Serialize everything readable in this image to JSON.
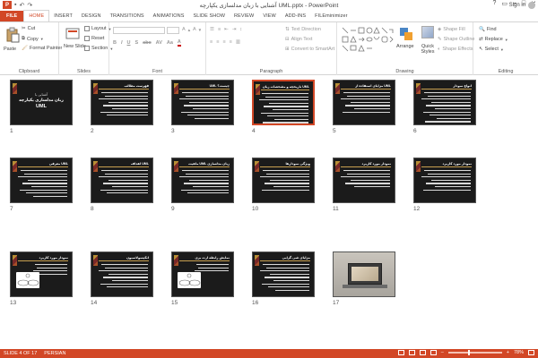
{
  "window": {
    "title": "آشنایی با زبان مدلسازی یکپارچه UML.pptx - PowerPoint",
    "app_icon": "P",
    "controls": [
      "?",
      "▭",
      "–",
      "□",
      "✕"
    ]
  },
  "qat": {
    "save_icon": "save-icon",
    "undo_icon": "undo-icon",
    "redo_icon": "redo-icon"
  },
  "tabs": [
    {
      "label": "FILE",
      "type": "file"
    },
    {
      "label": "HOME",
      "type": "active"
    },
    {
      "label": "INSERT",
      "type": ""
    },
    {
      "label": "DESIGN",
      "type": ""
    },
    {
      "label": "TRANSITIONS",
      "type": ""
    },
    {
      "label": "ANIMATIONS",
      "type": ""
    },
    {
      "label": "SLIDE SHOW",
      "type": ""
    },
    {
      "label": "REVIEW",
      "type": ""
    },
    {
      "label": "VIEW",
      "type": ""
    },
    {
      "label": "ADD-INS",
      "type": ""
    },
    {
      "label": "FILEminimizer",
      "type": ""
    }
  ],
  "signin": "Sign in",
  "ribbon": {
    "clipboard": {
      "label": "Clipboard",
      "paste": "Paste",
      "cut": "Cut",
      "copy": "Copy",
      "format_painter": "Format Painter"
    },
    "slides": {
      "label": "Slides",
      "new_slide": "New Slide",
      "layout": "Layout",
      "reset": "Reset",
      "section": "Section"
    },
    "font": {
      "label": "Font"
    },
    "paragraph": {
      "label": "Paragraph",
      "text_direction": "Text Direction",
      "align_text": "Align Text",
      "convert_smartart": "Convert to SmartArt"
    },
    "drawing": {
      "label": "Drawing",
      "arrange": "Arrange",
      "quick_styles": "Quick Styles",
      "shape_fill": "Shape Fill",
      "shape_outline": "Shape Outline",
      "shape_effects": "Shape Effects"
    },
    "editing": {
      "label": "Editing",
      "find": "Find",
      "replace": "Replace",
      "select": "Select"
    }
  },
  "slides": [
    {
      "num": "1",
      "kind": "title",
      "title": "آشنایی با",
      "subtitle": "زبان مدلسازی یکپارچه",
      "subtitle2": "UML"
    },
    {
      "num": "2",
      "kind": "text",
      "title": "فهرست مطالب",
      "lines": 8
    },
    {
      "num": "3",
      "kind": "text",
      "title": "UML چیست؟",
      "lines": 9
    },
    {
      "num": "4",
      "kind": "text",
      "title": "تاریخچه و مشخصات زبان UML",
      "lines": 10,
      "selected": true
    },
    {
      "num": "5",
      "kind": "text",
      "title": "مزایای استفاده از UML",
      "lines": 7
    },
    {
      "num": "6",
      "kind": "text",
      "title": "انواع نمودار",
      "lines": 10
    },
    {
      "num": "7",
      "kind": "text",
      "title": "معرفی UML",
      "lines": 9
    },
    {
      "num": "8",
      "kind": "text",
      "title": "اهداف UML",
      "lines": 8
    },
    {
      "num": "9",
      "kind": "text",
      "title": "ماهیت UML زبان مدلسازی",
      "lines": 8
    },
    {
      "num": "10",
      "kind": "text",
      "title": "ویژگی نمودارها",
      "lines": 7
    },
    {
      "num": "11",
      "kind": "text",
      "title": "نمودار مورد کاربرد",
      "lines": 6
    },
    {
      "num": "12",
      "kind": "text",
      "title": "نمودار مورد کاربرد",
      "lines": 7
    },
    {
      "num": "13",
      "kind": "diagram",
      "title": "نمودار مورد کاربرد",
      "lines": 4
    },
    {
      "num": "14",
      "kind": "text",
      "title": "انکپسولاسیون",
      "lines": 8
    },
    {
      "num": "15",
      "kind": "diagram",
      "title": "نمایش رابطه ارث بری",
      "lines": 3
    },
    {
      "num": "16",
      "kind": "text",
      "title": "مزایای شی گرایی",
      "lines": 9
    },
    {
      "num": "17",
      "kind": "photo",
      "title": "",
      "lines": 0
    }
  ],
  "status": {
    "slide_info": "SLIDE 4 OF 17",
    "language": "PERSIAN",
    "zoom": "78%",
    "zoom_value": 0.78
  },
  "colors": {
    "accent": "#d24726",
    "slide_bg": "#1b1b1b"
  }
}
